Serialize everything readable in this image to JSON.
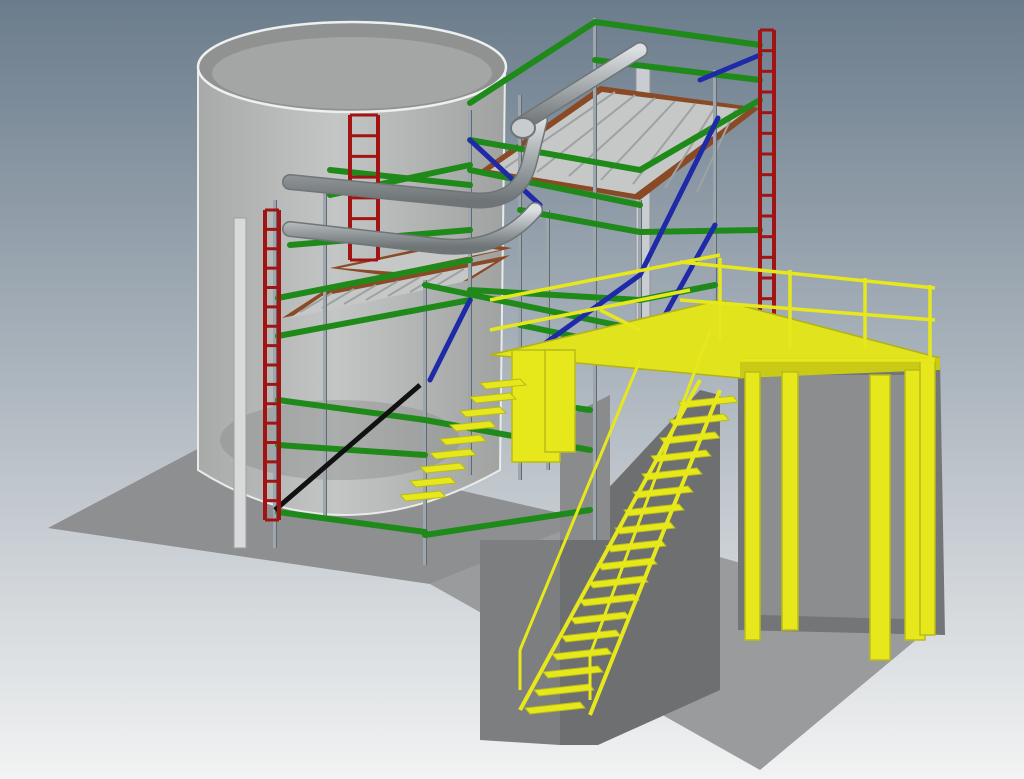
{
  "colors": {
    "background_top": "#6b7c8c",
    "background_bottom": "#f2f3f3",
    "ground": "#8c8d8e",
    "tank": "#b9bcba",
    "tank_edge": "#e8ebe9",
    "ledger_green": "#1f8a1a",
    "standard_silver": "#9ea6ad",
    "ladder_red": "#a11414",
    "brace_blue": "#1f2aa8",
    "deck_brown": "#8a4a26",
    "deck_plank": "#c9cbca",
    "pipe": "#a9adb0",
    "stair_yellow": "#e6e81c",
    "stair_yellow_dark": "#b9bb16",
    "concrete": "#7b7c7e",
    "concrete_light": "#9a9b9d"
  }
}
